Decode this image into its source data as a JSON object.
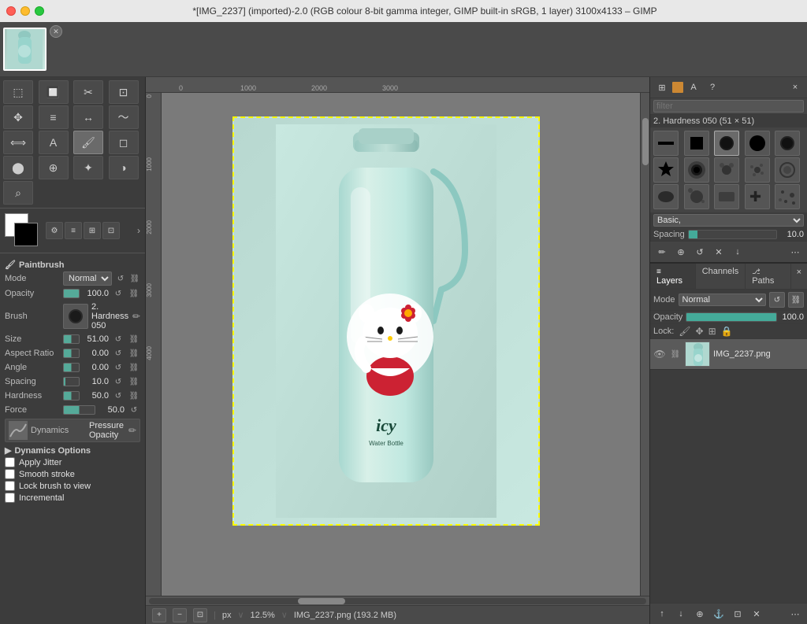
{
  "window": {
    "title": "*[IMG_2237] (imported)-2.0 (RGB colour 8-bit gamma integer, GIMP built-in sRGB, 1 layer) 3100x4133 – GIMP"
  },
  "titlebar": {
    "close": "×",
    "minimize": "–",
    "maximize": "+"
  },
  "toolbox": {
    "section": "Paintbrush",
    "mode_label": "Mode",
    "mode_value": "Normal",
    "opacity_label": "Opacity",
    "opacity_value": "100.0",
    "brush_label": "Brush",
    "brush_name": "2. Hardness 050",
    "size_label": "Size",
    "size_value": "51.00",
    "aspect_label": "Aspect Ratio",
    "aspect_value": "0.00",
    "angle_label": "Angle",
    "angle_value": "0.00",
    "spacing_label": "Spacing",
    "spacing_value": "10.0",
    "hardness_label": "Hardness",
    "hardness_value": "50.0",
    "force_label": "Force",
    "force_value": "50.0",
    "dynamics_label": "Dynamics",
    "dynamics_name": "Pressure Opacity",
    "dynamics_options": "Dynamics Options",
    "apply_jitter": "Apply Jitter",
    "smooth_stroke": "Smooth stroke",
    "lock_brush": "Lock brush to view",
    "incremental": "Incremental"
  },
  "brushes": {
    "filter_placeholder": "filter",
    "selected_name": "2. Hardness 050 (51 × 51)",
    "category": "Basic,",
    "spacing_label": "Spacing",
    "spacing_value": "10.0"
  },
  "layers": {
    "tabs": [
      "Layers",
      "Channels",
      "Paths"
    ],
    "active_tab": "Layers",
    "mode_label": "Mode",
    "mode_value": "Normal",
    "opacity_label": "Opacity",
    "opacity_value": "100.0",
    "lock_label": "Lock:",
    "items": [
      {
        "name": "IMG_2237.png",
        "visible": true
      }
    ]
  },
  "canvas": {
    "zoom": "12.5%",
    "filename": "IMG_2237.png",
    "filesize": "193.2 MB",
    "unit": "px"
  },
  "statusbar": {
    "unit": "px",
    "zoom": "12.5%",
    "filename": "IMG_2237.png (193.2 MB)"
  }
}
